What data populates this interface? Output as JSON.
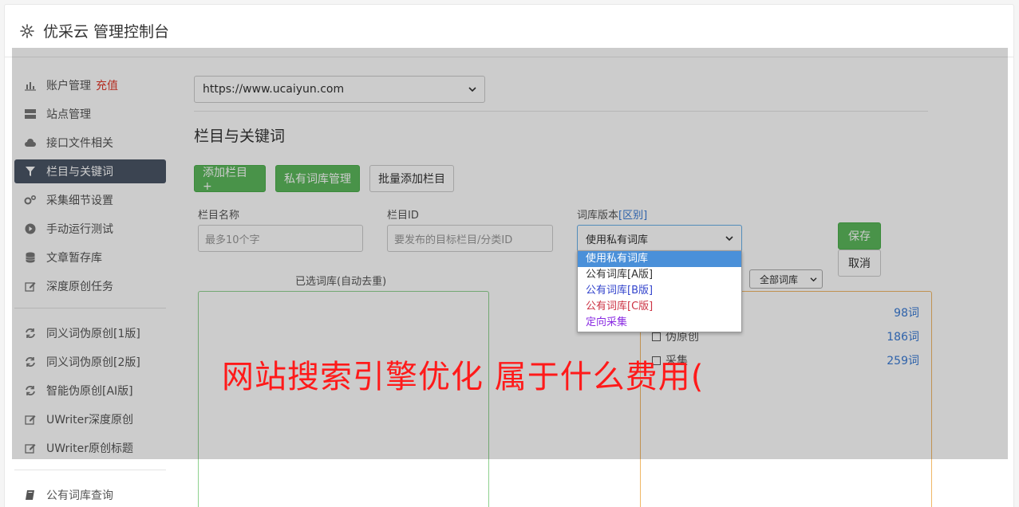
{
  "header": {
    "title": "优采云 管理控制台"
  },
  "sidebar": {
    "group1": [
      {
        "label": "账户管理",
        "badge": "充值",
        "icon": "bar-chart-icon"
      },
      {
        "label": "站点管理",
        "icon": "server-icon"
      },
      {
        "label": "接口文件相关",
        "icon": "cloud-upload-icon"
      },
      {
        "label": "栏目与关键词",
        "icon": "filter-icon",
        "active": true
      },
      {
        "label": "采集细节设置",
        "icon": "gears-icon"
      },
      {
        "label": "手动运行测试",
        "icon": "play-circle-icon"
      },
      {
        "label": "文章暂存库",
        "icon": "database-icon"
      },
      {
        "label": "深度原创任务",
        "icon": "edit-icon"
      }
    ],
    "group2": [
      {
        "label": "同义词伪原创[1版]",
        "icon": "refresh-icon"
      },
      {
        "label": "同义词伪原创[2版]",
        "icon": "refresh-icon"
      },
      {
        "label": "智能伪原创[AI版]",
        "icon": "refresh-icon"
      },
      {
        "label": "UWriter深度原创",
        "icon": "edit-icon"
      },
      {
        "label": "UWriter原创标题",
        "icon": "edit-icon"
      }
    ],
    "group3": [
      {
        "label": "公有词库查询",
        "icon": "book-icon"
      }
    ]
  },
  "main": {
    "site_select": "https://www.ucaiyun.com",
    "section_title": "栏目与关键词",
    "buttons": {
      "add_column": "添加栏目 +",
      "private_lib": "私有词库管理",
      "batch_add": "批量添加栏目"
    },
    "form": {
      "column_name_label": "栏目名称",
      "column_name_placeholder": "最多10个字",
      "column_id_label": "栏目ID",
      "column_id_placeholder": "要发布的目标栏目/分类ID",
      "lib_version_label": "词库版本",
      "lib_version_link": "[区别]",
      "lib_version_value": "使用私有词库",
      "save": "保存",
      "cancel": "取消"
    },
    "selected_lib_title": "已选词库(自动去重)",
    "all_lib_select": "全部词库",
    "lib_items": [
      {
        "name": "",
        "count": "98词"
      },
      {
        "name": "伪原创",
        "count": "186词"
      },
      {
        "name": "采集",
        "count": "259词"
      }
    ]
  },
  "dropdown": {
    "options": [
      {
        "label": "使用私有词库",
        "color": "#ffffff",
        "selected": true
      },
      {
        "label": "公有词库[A版]",
        "color": "#333333"
      },
      {
        "label": "公有词库[B版]",
        "color": "#3344cc"
      },
      {
        "label": "公有词库[C版]",
        "color": "#cc3344"
      },
      {
        "label": "定向采集",
        "color": "#8a2be2"
      }
    ]
  },
  "watermark": "网站搜索引擎优化 属于什么费用("
}
